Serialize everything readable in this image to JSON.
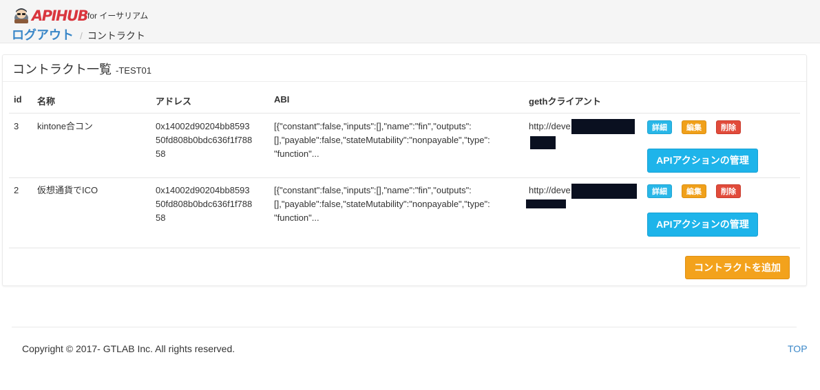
{
  "header": {
    "logo_text": "APIHUB",
    "for_text": "for イーサリアム",
    "breadcrumb": {
      "link": "ログアウト",
      "separator": "/",
      "current": "コントラクト"
    }
  },
  "panel": {
    "title": "コントラクト一覧",
    "subtitle": "-TEST01"
  },
  "table": {
    "columns": [
      "id",
      "名称",
      "アドレス",
      "ABI",
      "gethクライアント"
    ],
    "rows": [
      {
        "id": "3",
        "name": "kintone合コン",
        "address": "0x14002d90204bb8593 50fd808b0bdc636f1f788 58",
        "address_lines": [
          "0x14002d90204bb8593",
          "50fd808b0bdc636f1f788",
          "58"
        ],
        "abi_lines": [
          "[{\"constant\":false,\"inputs\":[],\"name\":\"fin\",\"outputs\":",
          "[],\"payable\":false,\"stateMutability\":\"nonpayable\",\"type\":",
          "\"function\"..."
        ],
        "geth": "http://deve"
      },
      {
        "id": "2",
        "name": "仮想通貨でICO",
        "address_lines": [
          "0x14002d90204bb8593",
          "50fd808b0bdc636f1f788",
          "58"
        ],
        "abi_lines": [
          "[{\"constant\":false,\"inputs\":[],\"name\":\"fin\",\"outputs\":",
          "[],\"payable\":false,\"stateMutability\":\"nonpayable\",\"type\":",
          "\"function\"..."
        ],
        "geth": "http://deve"
      }
    ],
    "buttons": {
      "detail": "詳細",
      "edit": "編集",
      "delete": "削除",
      "api": "APIアクションの管理"
    }
  },
  "add_button": "コントラクトを追加",
  "footer": {
    "copyright": "Copyright © 2017- GTLAB Inc. All rights reserved.",
    "top_link": "TOP"
  },
  "colors": {
    "link": "#3a87c8",
    "info": "#29b7e8",
    "warning": "#f0a01a",
    "danger": "#e14b3b",
    "logo": "#d9363e"
  }
}
